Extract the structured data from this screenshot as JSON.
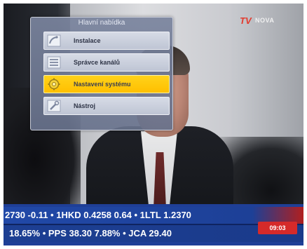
{
  "menu": {
    "title": "Hlavní nabídka",
    "items": [
      {
        "label": "Instalace",
        "icon": "satellite-dish-icon",
        "selected": false
      },
      {
        "label": "Správce kanálů",
        "icon": "channel-list-icon",
        "selected": false
      },
      {
        "label": "Nastavení systému",
        "icon": "gear-icon",
        "selected": true
      },
      {
        "label": "Nástroj",
        "icon": "tools-icon",
        "selected": false
      }
    ]
  },
  "channel_logo": {
    "prefix": "TV",
    "name": "NOVA"
  },
  "ticker": {
    "row1": "2730 -0.11 • 1HKD 0.4258 0.64 • 1LTL 1.2370",
    "row2": "18.65% • PPS  38.30  7.88% • JCA  29.40",
    "clock": "09:03"
  },
  "colors": {
    "menu_bg": "#7a849e",
    "highlight": "#ffc800",
    "ticker_bg": "#1f3f97",
    "clock_bg": "#d52a2a"
  }
}
